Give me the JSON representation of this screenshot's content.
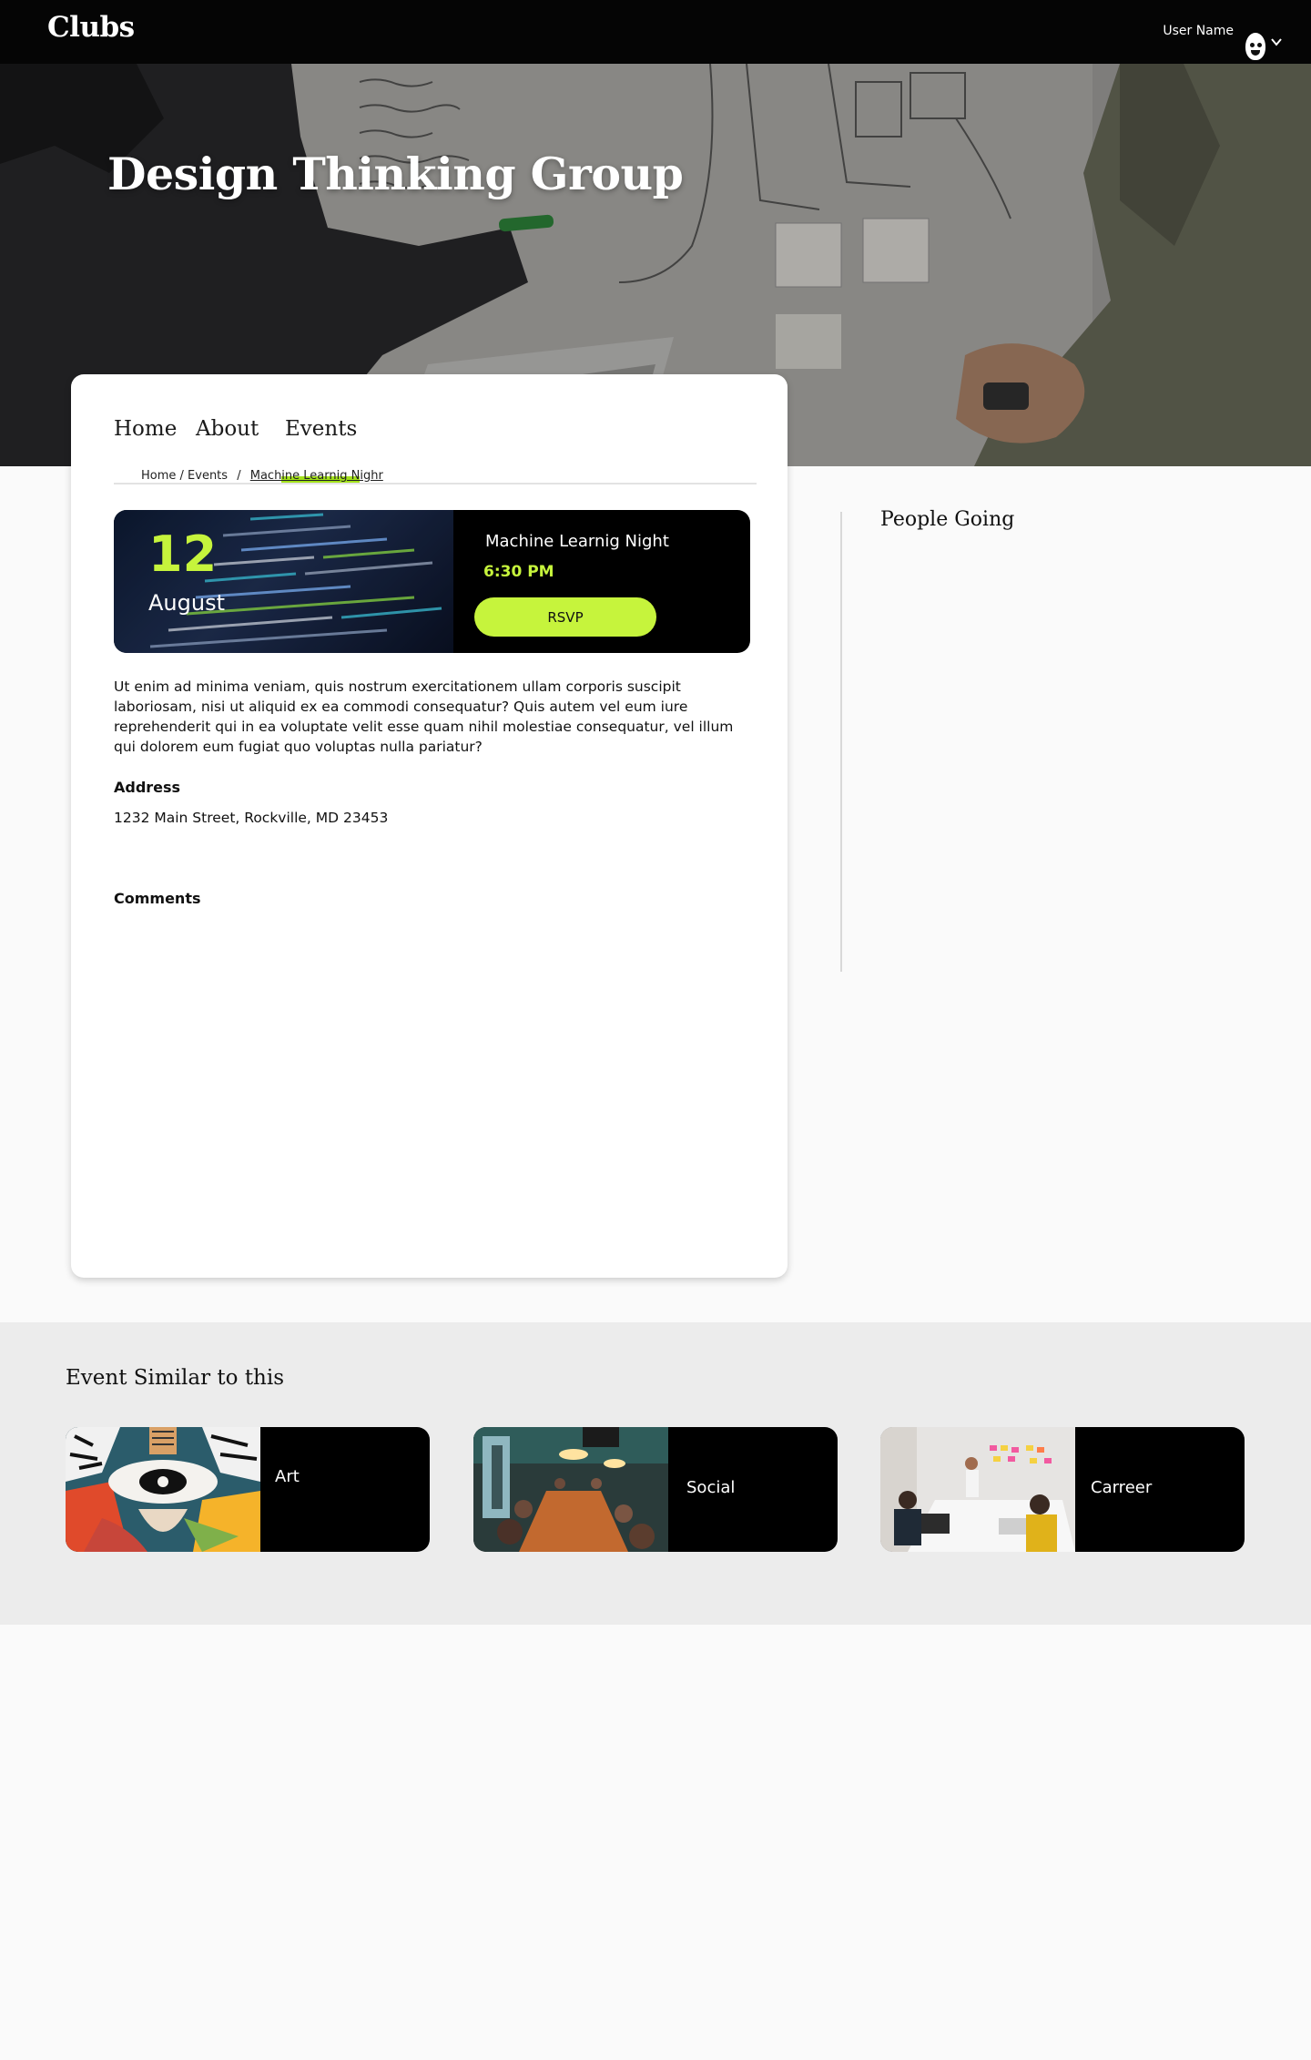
{
  "header": {
    "brand": "Clubs",
    "user_name": "User Name"
  },
  "hero": {
    "title": "Design Thinking Group"
  },
  "tabs": [
    {
      "label": "Home"
    },
    {
      "label": "About"
    },
    {
      "label": "Events",
      "active": true
    }
  ],
  "breadcrumb": {
    "path": "Home / Events",
    "separator": "/",
    "current": "Machine Learnig Nighr"
  },
  "event": {
    "day": "12",
    "month": "August",
    "name": "Machine Learnig Night",
    "time": "6:30 PM",
    "rsvp_label": "RSVP",
    "description": "Ut enim ad minima veniam, quis nostrum exercitationem ullam corporis suscipit laboriosam, nisi ut aliquid ex ea commodi consequatur? Quis autem vel eum iure reprehenderit qui in ea voluptate velit esse quam nihil molestiae consequatur, vel illum qui dolorem eum fugiat quo voluptas nulla pariatur?",
    "address_heading": "Address",
    "address": "1232 Main Street, Rockville, MD 23453",
    "comments_heading": "Comments"
  },
  "sidebar": {
    "people_going": "People Going"
  },
  "similar": {
    "title": "Event Similar to this",
    "items": [
      {
        "label": "Art"
      },
      {
        "label": "Social"
      },
      {
        "label": "Carreer"
      }
    ]
  },
  "colors": {
    "accent": "#c6f43c",
    "tab_underline": "#a3e21a",
    "topbar": "#050505"
  }
}
